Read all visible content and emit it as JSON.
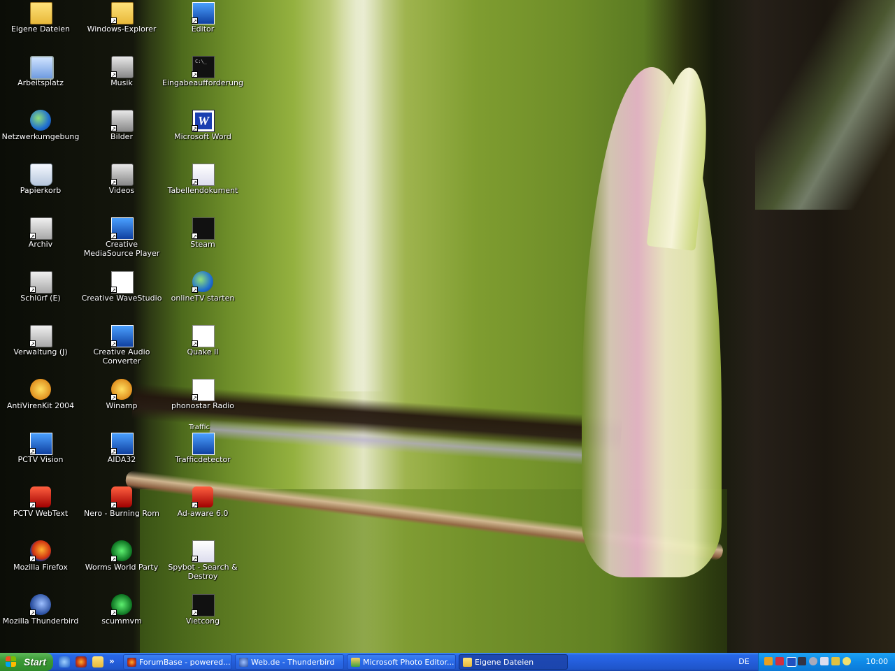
{
  "desktop": {
    "icons": [
      {
        "label": "Eigene Dateien",
        "icon": "my-documents-folder-icon",
        "shortcut": false
      },
      {
        "label": "Arbeitsplatz",
        "icon": "my-computer-icon",
        "shortcut": false
      },
      {
        "label": "Netzwerkumgebung",
        "icon": "network-places-icon",
        "shortcut": false
      },
      {
        "label": "Papierkorb",
        "icon": "recycle-bin-icon",
        "shortcut": false
      },
      {
        "label": "Archiv",
        "icon": "drive-icon",
        "shortcut": true
      },
      {
        "label": "Schlürf (E)",
        "icon": "drive-icon",
        "shortcut": true
      },
      {
        "label": "Verwaltung (J)",
        "icon": "drive-icon",
        "shortcut": true
      },
      {
        "label": "AntiVirenKit 2004",
        "icon": "antivirus-icon",
        "shortcut": false
      },
      {
        "label": "PCTV Vision",
        "icon": "pctv-vision-icon",
        "shortcut": true
      },
      {
        "label": "PCTV WebText",
        "icon": "pctv-webtext-icon",
        "shortcut": true
      },
      {
        "label": "Mozilla Firefox",
        "icon": "firefox-icon",
        "shortcut": true
      },
      {
        "label": "Mozilla Thunderbird",
        "icon": "thunderbird-icon",
        "shortcut": true
      },
      {
        "label": "Windows-Explorer",
        "icon": "explorer-icon",
        "shortcut": true
      },
      {
        "label": "Musik",
        "icon": "music-icon",
        "shortcut": true
      },
      {
        "label": "Bilder",
        "icon": "pictures-icon",
        "shortcut": true
      },
      {
        "label": "Videos",
        "icon": "videos-icon",
        "shortcut": true
      },
      {
        "label": "Creative MediaSource Player",
        "icon": "media-player-icon",
        "shortcut": true
      },
      {
        "label": "Creative WaveStudio",
        "icon": "wavestudio-icon",
        "shortcut": true
      },
      {
        "label": "Creative Audio Converter",
        "icon": "audio-converter-icon",
        "shortcut": true
      },
      {
        "label": "Winamp",
        "icon": "winamp-icon",
        "shortcut": true
      },
      {
        "label": "AIDA32",
        "icon": "aida32-icon",
        "shortcut": true
      },
      {
        "label": "Nero - Burning Rom",
        "icon": "nero-icon",
        "shortcut": true
      },
      {
        "label": "Worms World Party",
        "icon": "worms-icon",
        "shortcut": true
      },
      {
        "label": "scummvm",
        "icon": "scummvm-icon",
        "shortcut": true
      },
      {
        "label": "Editor",
        "icon": "notepad-icon",
        "shortcut": true
      },
      {
        "label": "Eingabeaufforderung",
        "icon": "command-prompt-icon",
        "shortcut": true
      },
      {
        "label": "Microsoft Word",
        "icon": "word-icon",
        "shortcut": true
      },
      {
        "label": "Tabellendokument",
        "icon": "spreadsheet-icon",
        "shortcut": true
      },
      {
        "label": "Steam",
        "icon": "steam-icon",
        "shortcut": true
      },
      {
        "label": "onlineTV starten",
        "icon": "online-tv-icon",
        "shortcut": true
      },
      {
        "label": "Quake II",
        "icon": "quake-icon",
        "shortcut": true
      },
      {
        "label": "phonostar Radio",
        "icon": "radio-icon",
        "shortcut": true
      },
      {
        "label": "Trafficdetector",
        "icon": "traffic-icon",
        "shortcut": false,
        "badge": "Traffic"
      },
      {
        "label": "Ad-aware 6.0",
        "icon": "adaware-icon",
        "shortcut": true
      },
      {
        "label": "Spybot - Search & Destroy",
        "icon": "spybot-icon",
        "shortcut": true
      },
      {
        "label": "Vietcong",
        "icon": "vietcong-icon",
        "shortcut": true
      }
    ],
    "cmd_text": "C:\\_"
  },
  "taskbar": {
    "start_label": "Start",
    "quick_launch_overflow": "»",
    "tasks": [
      {
        "label": "ForumBase - powered...",
        "icon": "firefox-icon",
        "active": false
      },
      {
        "label": "Web.de - Thunderbird",
        "icon": "thunderbird-icon",
        "active": false
      },
      {
        "label": "Microsoft Photo Editor...",
        "icon": "photo-editor-icon",
        "active": false
      },
      {
        "label": "Eigene Dateien",
        "icon": "folder-icon",
        "active": true
      }
    ],
    "language": "DE",
    "clock": "10:00",
    "colors": {
      "taskbar": "#245edb",
      "start": "#3c9a36",
      "tray": "#0e8ae8"
    }
  }
}
